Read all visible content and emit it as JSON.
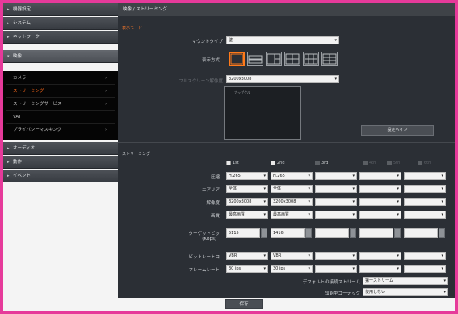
{
  "sidebar": {
    "items": [
      {
        "label": "機器設定"
      },
      {
        "label": "システム"
      },
      {
        "label": "ネットワーク"
      },
      {
        "label": "映像"
      },
      {
        "label": "オーディオ"
      },
      {
        "label": "動作"
      },
      {
        "label": "イベント"
      }
    ],
    "submenu": [
      {
        "label": "カメラ"
      },
      {
        "label": "ストリーミング"
      },
      {
        "label": "ストリーミングサービス"
      },
      {
        "label": "VAT"
      },
      {
        "label": "プライバシーマスキング"
      }
    ]
  },
  "main": {
    "title": "映像 / ストリーミング",
    "display_mode_section": "表示モード",
    "mount_type_label": "マウントタイプ",
    "mount_type_value": "壁",
    "display_method_label": "表示方式",
    "full_resolution_label": "フルスクリーン解像度",
    "full_resolution_value": "3200x3008",
    "preview_caption": "ナップクル",
    "setting_button": "設定ベイン",
    "streaming_section": "ストリーミング",
    "streams": [
      {
        "label": "1st",
        "checked": true
      },
      {
        "label": "2nd",
        "checked": true
      },
      {
        "label": "3rd",
        "checked": false
      },
      {
        "label": "4th",
        "checked": false
      },
      {
        "label": "5th",
        "checked": false
      },
      {
        "label": "6th",
        "checked": false
      }
    ],
    "row_labels": {
      "codec": "圧縮",
      "area": "エアリア",
      "resolution": "解像度",
      "quality": "画質",
      "target_bitrate": "ターゲットビッ",
      "target_bitrate_unit": "(Kbps)",
      "bitrate_control": "ビットレートコ",
      "framerate": "フレームレート"
    },
    "stream1": {
      "codec": "H.265",
      "area": "全体",
      "resolution": "3200x3008",
      "quality": "最高画質",
      "bitrate": "5115",
      "bitrate_control": "VBR",
      "framerate": "30 ips"
    },
    "stream2": {
      "codec": "H.265",
      "area": "全体",
      "resolution": "3200x3008",
      "quality": "最高画質",
      "bitrate": "1416",
      "bitrate_control": "VBR",
      "framerate": "30 ips"
    },
    "default_stream_label": "デフォルトの接続ストリーム",
    "default_stream_value": "第一ストリーム",
    "smart_codec_label": "知能型コーデック",
    "smart_codec_value": "使用しない"
  },
  "footer": {
    "save_label": "保存"
  },
  "colors": {
    "accent": "#ff7a1a",
    "border": "#e63a9a",
    "panel": "#2b2f35"
  }
}
